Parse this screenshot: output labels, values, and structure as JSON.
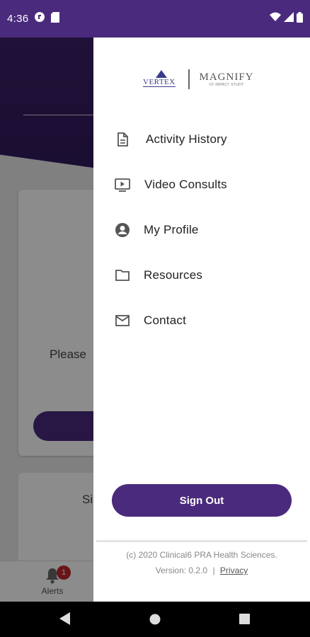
{
  "status_bar": {
    "time": "4:36",
    "icons_left": [
      "cloud-icon",
      "sd-card-icon"
    ],
    "icons_right": [
      "wifi-icon",
      "signal-icon",
      "battery-icon"
    ]
  },
  "background": {
    "card_text": "Please",
    "card2_text": "Si",
    "tab_alerts_label": "Alerts",
    "alerts_badge": "1"
  },
  "drawer": {
    "logo": {
      "left": "VERTEX",
      "right": "MAGNIFY",
      "right_sub": "CF IMPACT STUDY"
    },
    "items": [
      {
        "label": "Activity History",
        "icon": "document-icon"
      },
      {
        "label": "Video Consults",
        "icon": "video-icon"
      },
      {
        "label": "My Profile",
        "icon": "account-icon"
      },
      {
        "label": "Resources",
        "icon": "folder-icon"
      },
      {
        "label": "Contact",
        "icon": "mail-icon"
      }
    ],
    "sign_out_label": "Sign Out",
    "copyright": "(c) 2020 Clinical6 PRA Health Sciences.",
    "version_text": "Version: 0.2.0",
    "separator": "|",
    "privacy_label": "Privacy"
  },
  "colors": {
    "accent": "#4a2a7c",
    "header": "#3a1f66",
    "badge": "#c0262d"
  }
}
